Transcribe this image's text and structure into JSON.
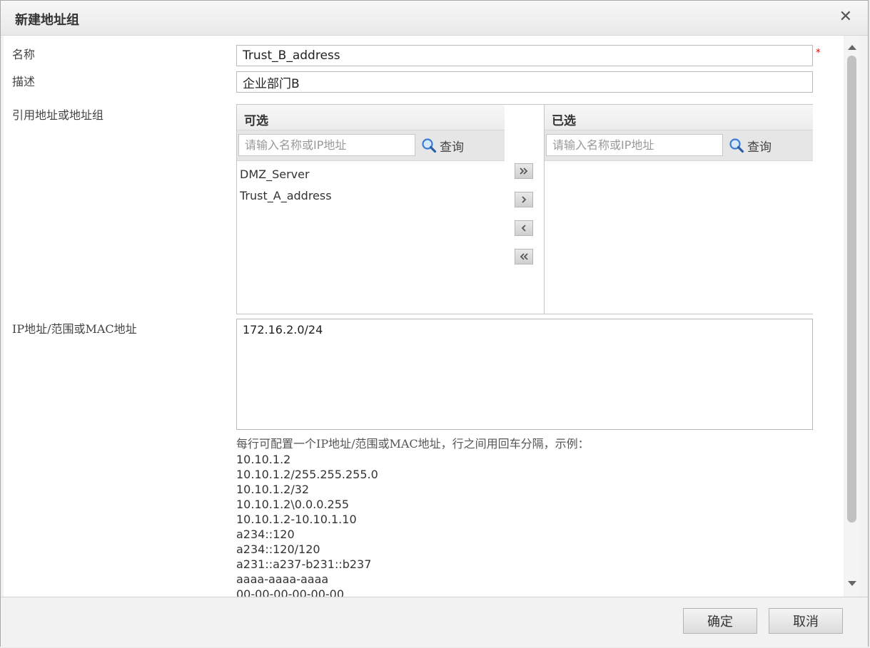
{
  "dialog": {
    "title": "新建地址组",
    "close_icon": "close-icon"
  },
  "form": {
    "name_label": "名称",
    "name_value": "Trust_B_address",
    "required_mark": "*",
    "desc_label": "描述",
    "desc_value": "企业部门B",
    "ref_label": "引用地址或地址组",
    "available": {
      "header": "可选",
      "search_placeholder": "请输入名称或IP地址",
      "search_label": "查询",
      "items": [
        "DMZ_Server",
        "Trust_A_address"
      ]
    },
    "selected": {
      "header": "已选",
      "search_placeholder": "请输入名称或IP地址",
      "search_label": "查询",
      "items": []
    },
    "move_buttons": [
      "move-all-right-icon",
      "move-right-icon",
      "move-left-icon",
      "move-all-left-icon"
    ],
    "ip_label": "IP地址/范围或MAC地址",
    "ip_value": "172.16.2.0/24",
    "help_title": "每行可配置一个IP地址/范围或MAC地址，行之间用回车分隔，示例：",
    "help_examples": [
      "10.10.1.2",
      "10.10.1.2/255.255.255.0",
      "10.10.1.2/32",
      "10.10.1.2\\0.0.0.255",
      "10.10.1.2-10.10.1.10",
      "a234::120",
      "a234::120/120",
      "a231::a237-b231::b237",
      "aaaa-aaaa-aaaa",
      "00-00-00-00-00-00"
    ]
  },
  "footer": {
    "ok_label": "确定",
    "cancel_label": "取消"
  },
  "colors": {
    "required": "#dd0000",
    "scroll_thumb": "#c1c1c1",
    "search_icon": "#3a7bd5"
  }
}
